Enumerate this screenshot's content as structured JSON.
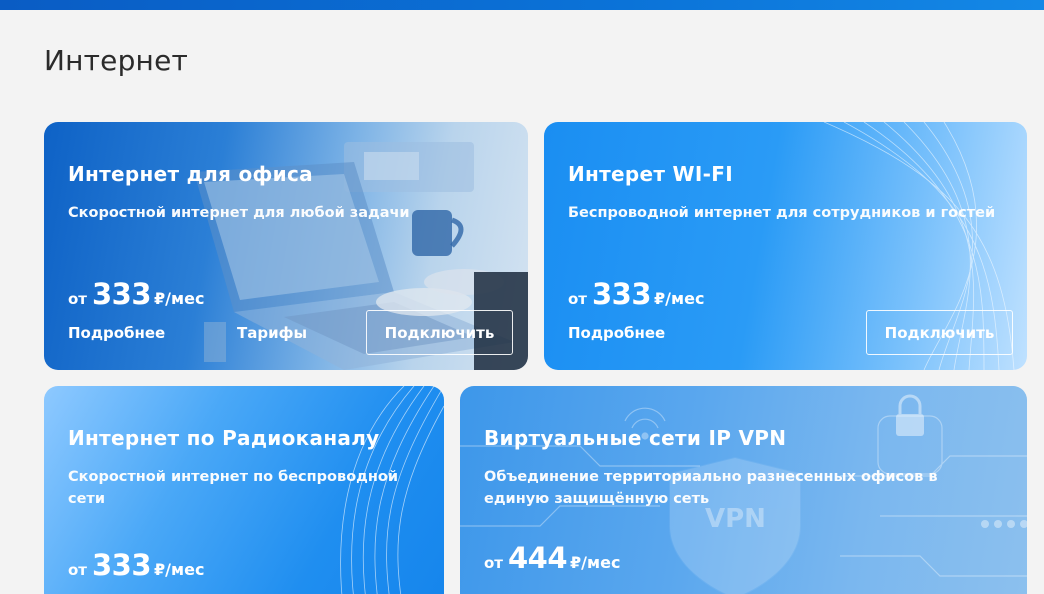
{
  "page": {
    "title": "Интернет"
  },
  "cards": [
    {
      "title": "Интернет для офиса",
      "desc": "Скоростной интернет для любой задачи",
      "price_from": "от",
      "price_amount": "333",
      "price_unit": "₽/мес",
      "more_label": "Подробнее",
      "tariffs_label": "Тарифы",
      "connect_label": "Подключить"
    },
    {
      "title": "Интерет WI-FI",
      "desc": "Беспроводной интернет для сотрудников и гостей",
      "price_from": "от",
      "price_amount": "333",
      "price_unit": "₽/мес",
      "more_label": "Подробнее",
      "connect_label": "Подключить"
    },
    {
      "title": "Интернет по Радиоканалу",
      "desc": "Скоростной интернет по беспроводной сети",
      "price_from": "от",
      "price_amount": "333",
      "price_unit": "₽/мес"
    },
    {
      "title": "Виртуальные сети IP VPN",
      "desc": "Объединение территориально разнесенных офисов в единую защищённую сеть",
      "price_from": "от",
      "price_amount": "444",
      "price_unit": "₽/мес",
      "vpn_badge": "VPN"
    }
  ]
}
